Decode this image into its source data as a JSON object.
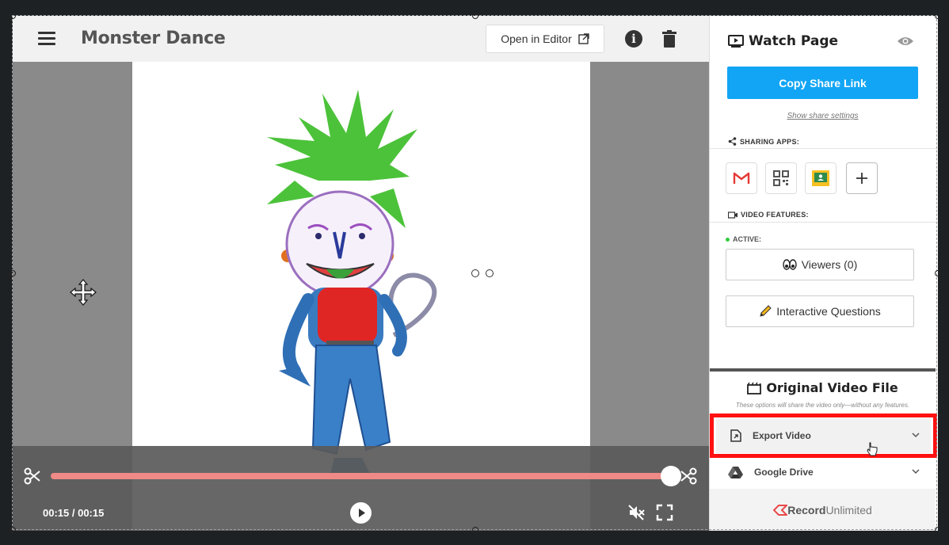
{
  "header": {
    "title": "Monster Dance",
    "open_editor_label": "Open in Editor"
  },
  "player": {
    "time_display": "00:15 / 00:15",
    "progress": 1.0
  },
  "panel": {
    "watch_page_label": "Watch Page",
    "copy_share_link_label": "Copy Share Link",
    "show_share_settings_label": "Show share settings",
    "sharing_apps_label": "SHARING APPS:",
    "video_features_label": "VIDEO FEATURES:",
    "active_label": "ACTIVE:",
    "viewers_label": "Viewers (0)",
    "interactive_questions_label": "Interactive Questions",
    "original_video_file_label": "Original Video File",
    "original_note": "These options will share the video only—without any features.",
    "export_video_label": "Export Video",
    "google_drive_label": "Google Drive",
    "footer_brand_bold": "Record",
    "footer_brand_light": "Unlimited"
  },
  "colors": {
    "accent": "#12a5f5",
    "progress": "#f08a86",
    "highlight": "#ff1111",
    "active_dot": "#2ecc40"
  },
  "icons": [
    "menu-icon",
    "external-link-icon",
    "info-icon",
    "trash-icon",
    "move-icon",
    "scissors-icon",
    "play-icon",
    "mute-icon",
    "fullscreen-icon",
    "watch-page-icon",
    "eye-icon",
    "share-icon",
    "gmail-icon",
    "qr-code-icon",
    "google-classroom-icon",
    "plus-icon",
    "video-camera-icon",
    "eyes-icon",
    "pencil-icon",
    "film-icon",
    "export-file-icon",
    "google-drive-icon",
    "chevron-down-icon",
    "pointer-cursor-icon",
    "recordunlimited-logo-icon"
  ]
}
